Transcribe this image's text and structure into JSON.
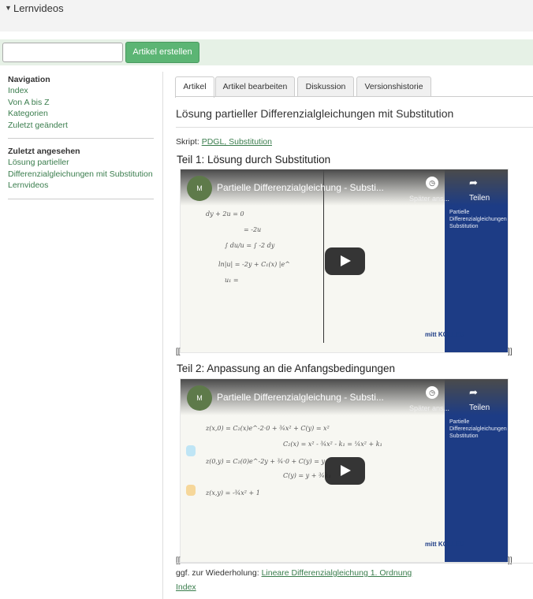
{
  "header": {
    "caret": "▼",
    "title": "Lernvideos"
  },
  "search": {
    "placeholder": "",
    "button_label": "Artikel erstellen"
  },
  "sidebar": {
    "nav_heading": "Navigation",
    "nav_items": [
      "Index",
      "Von A bis Z",
      "Kategorien",
      "Zuletzt geändert"
    ],
    "recent_heading": "Zuletzt angesehen",
    "recent_items": [
      "Lösung partieller",
      "Differenzialgleichungen mit Substitution",
      "Lernvideos"
    ]
  },
  "tabs": [
    "Artikel",
    "Artikel bearbeiten",
    "Diskussion",
    "Versionshistorie"
  ],
  "page_title": "Lösung partieller Differenzialgleichungen mit Substitution",
  "skript": {
    "label": "Skript: ",
    "link": "PDGL, Substitution"
  },
  "part1": {
    "heading": "Teil 1: Lösung durch Substitution",
    "video": {
      "title": "Partielle Differenzialgleichung - Substi...",
      "later": "Später ans...",
      "share": "Teilen",
      "side_text": "Partielle Differenzialgleichungen Substitution",
      "brand": "mitt KOLLEG"
    }
  },
  "part2": {
    "heading": "Teil 2: Anpassung an die Anfangsbedingungen",
    "video": {
      "title": "Partielle Differenzialgleichung - Substi...",
      "later": "Später ans...",
      "share": "Teilen",
      "side_text": "Partielle Differenzialgleichungen Substitution",
      "brand": "mitt KOLLEG"
    }
  },
  "bracket_open": "[[",
  "bracket_close": "]]",
  "footer": {
    "refresh_label": "ggf. zur Wiederholung: ",
    "refresh_link": "Lineare Differenzialgleichung 1. Ordnung",
    "index_link": "Index"
  }
}
